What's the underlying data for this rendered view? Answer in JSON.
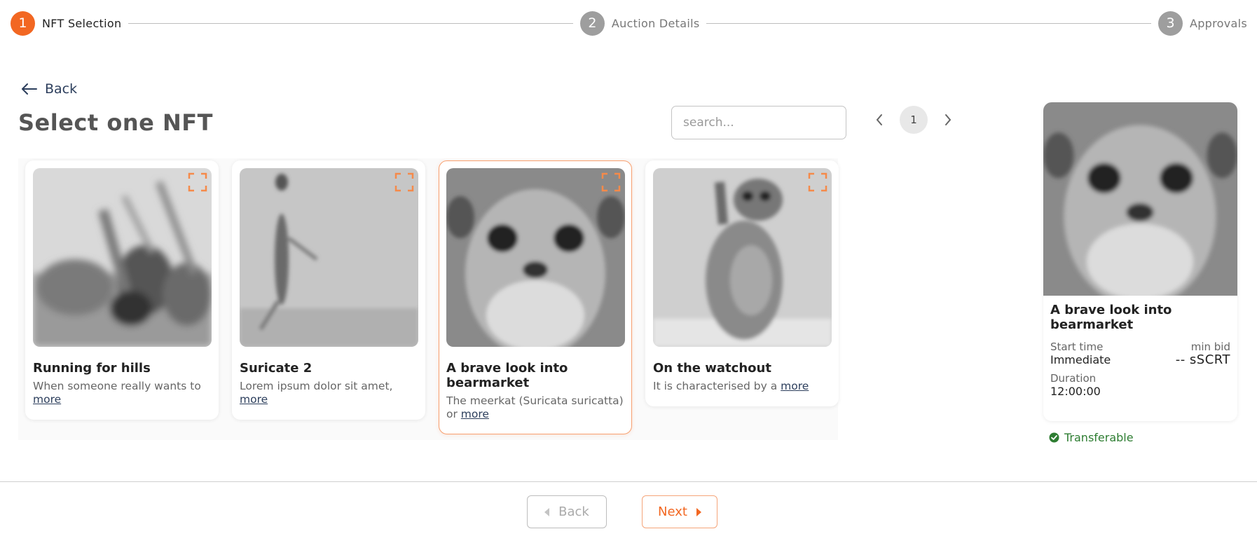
{
  "stepper": {
    "steps": [
      {
        "num": "1",
        "label": "NFT Selection"
      },
      {
        "num": "2",
        "label": "Auction Details"
      },
      {
        "num": "3",
        "label": "Approvals"
      }
    ]
  },
  "back_link": "Back",
  "page_title": "Select one NFT",
  "search": {
    "placeholder": "search...",
    "value": ""
  },
  "pagination": {
    "current_page": "1"
  },
  "cards": [
    {
      "title": "Running for hills",
      "desc": "When someone really wants to",
      "more": "more"
    },
    {
      "title": "Suricate 2",
      "desc": "Lorem ipsum dolor sit amet,",
      "more": "more"
    },
    {
      "title": "A brave look into bearmarket",
      "desc": "The meerkat (Suricata suricatta) or",
      "more": "more"
    },
    {
      "title": "On the watchout",
      "desc": "It is characterised by a",
      "more": "more"
    }
  ],
  "preview": {
    "title": "A brave look into bearmarket",
    "start_time_label": "Start time",
    "start_time_value": "Immediate",
    "min_bid_label": "min bid",
    "min_bid_value": "-- sSCRT",
    "duration_label": "Duration",
    "duration_value": "12:00:00",
    "transferable": "Transferable"
  },
  "footer": {
    "back_label": "Back",
    "next_label": "Next"
  },
  "colors": {
    "accent": "#f26722",
    "inactive_step": "#9e9e9e",
    "success": "#2e7d32",
    "link": "#2c3e5c"
  }
}
